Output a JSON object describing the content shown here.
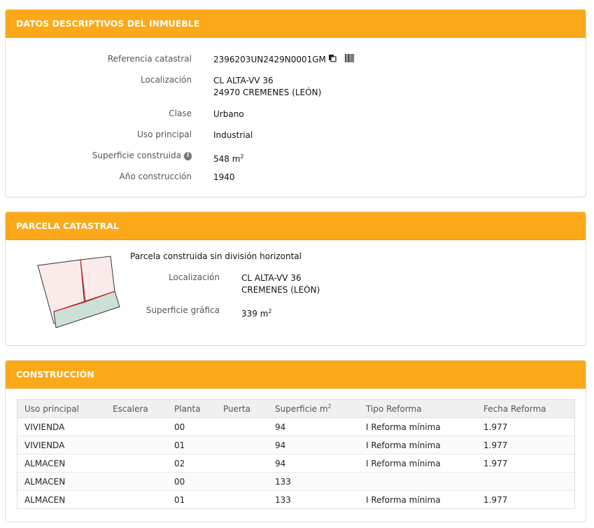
{
  "inmueble": {
    "title": "DATOS DESCRIPTIVOS DEL INMUEBLE",
    "referencia_label": "Referencia catastral",
    "referencia_value": "2396203UN2429N0001GM",
    "localizacion_label": "Localización",
    "localizacion_line1": "CL ALTA-VV 36",
    "localizacion_line2": "24970 CREMENES (LEÓN)",
    "clase_label": "Clase",
    "clase_value": "Urbano",
    "uso_label": "Uso principal",
    "uso_value": "Industrial",
    "superficie_label": "Superficie construida",
    "superficie_value": "548 m",
    "superficie_unit_sup": "2",
    "anio_label": "Año construcción",
    "anio_value": "1940"
  },
  "parcela": {
    "title": "PARCELA CATASTRAL",
    "descripcion": "Parcela construida sin división horizontal",
    "localizacion_label": "Localización",
    "localizacion_line1": "CL ALTA-VV 36",
    "localizacion_line2": "CREMENES (LEÓN)",
    "superficie_label": "Superficie gráfica",
    "superficie_value": "339 m",
    "superficie_unit_sup": "2"
  },
  "construccion": {
    "title": "CONSTRUCCIÓN",
    "headers": [
      "Uso principal",
      "Escalera",
      "Planta",
      "Puerta",
      "Superficie m",
      "Tipo Reforma",
      "Fecha Reforma"
    ],
    "superficie_header_sup": "2",
    "rows": [
      [
        "VIVIENDA",
        "",
        "00",
        "",
        "94",
        "I Reforma mínima",
        "1.977"
      ],
      [
        "VIVIENDA",
        "",
        "01",
        "",
        "94",
        "I Reforma mínima",
        "1.977"
      ],
      [
        "ALMACEN",
        "",
        "02",
        "",
        "94",
        "I Reforma mínima",
        "1.977"
      ],
      [
        "ALMACEN",
        "",
        "00",
        "",
        "133",
        "",
        ""
      ],
      [
        "ALMACEN",
        "",
        "01",
        "",
        "133",
        "I Reforma mínima",
        "1.977"
      ]
    ]
  }
}
